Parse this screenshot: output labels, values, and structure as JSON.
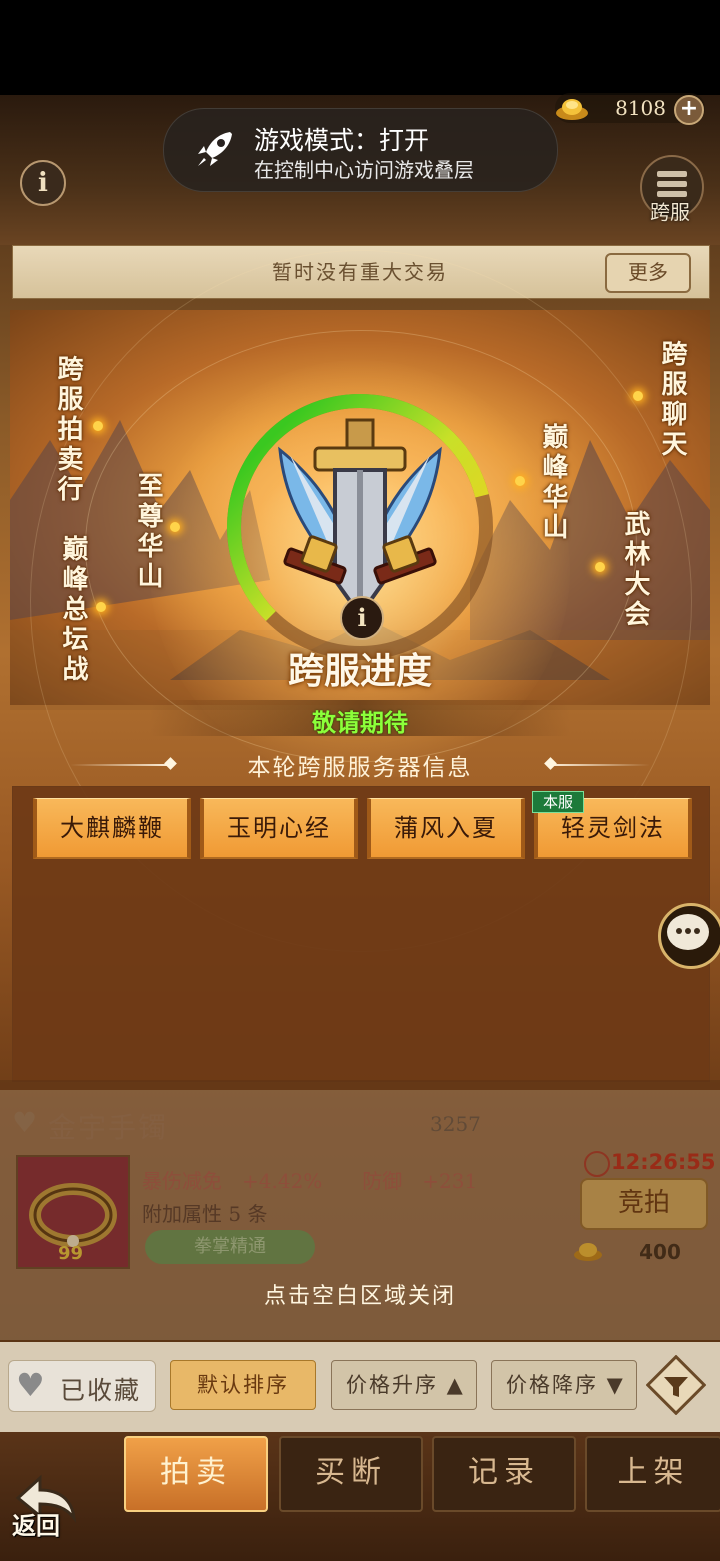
{
  "toast": {
    "title": "游戏模式：打开",
    "subtitle": "在控制中心访问游戏叠层",
    "icon": "rocket-icon"
  },
  "currency": {
    "amount": "8108",
    "icon": "gold-ingot-icon",
    "add_icon": "plus-icon"
  },
  "header": {
    "cross_server_label": "跨服",
    "info_icon": "info-icon"
  },
  "banner": {
    "text": "暂时没有重大交易",
    "more_label": "更多"
  },
  "map_labels": {
    "cross_server_auction": "跨服拍卖行",
    "peak_forum_battle": "巅峰总坛战",
    "supreme_huashan": "至尊华山",
    "peak_huashan": "巅峰华山",
    "cross_server_chat": "跨服聊天",
    "martial_arts_conference": "武林大会"
  },
  "progress": {
    "title": "跨服进度",
    "status": "敬请期待",
    "ring_fill": 0.78
  },
  "server_info": {
    "title": "本轮跨服服务器信息",
    "own_tag": "本服",
    "servers": [
      "大麒麟鞭",
      "玉明心经",
      "蒲风入夏",
      "轻灵剑法"
    ]
  },
  "background_item": {
    "name": "金宇手镯",
    "price": "3257",
    "level": "99",
    "stat_line1": "暴伤减免　+4.42%　　防御　+231",
    "stat_line2": "附加属性 5 条",
    "skill": "拳掌精通",
    "timer": "12:26:55",
    "bid_label": "竞拍",
    "bid_amount": "400"
  },
  "close_hint": "点击空白区域关闭",
  "filters": {
    "favorites_label": "已收藏",
    "sort_default": "默认排序",
    "sort_price_asc": "价格升序 ▲",
    "sort_price_desc": "价格降序 ▼"
  },
  "tabs": [
    "拍卖",
    "买断",
    "记录",
    "上架"
  ],
  "back_label": "返回",
  "colors": {
    "status_green": "#8cff3a",
    "accent_orange": "#f09a34",
    "own_server_green": "#1c7a3a"
  }
}
